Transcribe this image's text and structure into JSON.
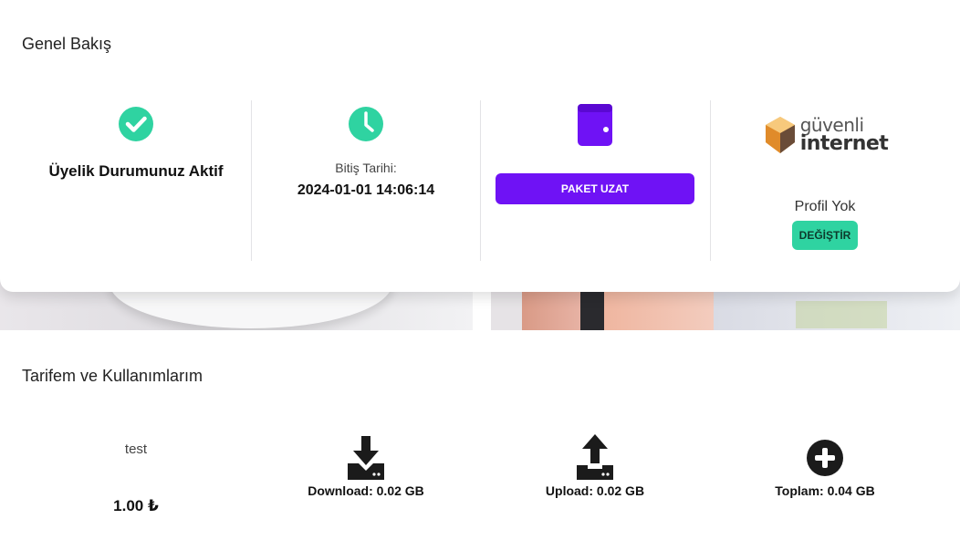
{
  "overview": {
    "title": "Genel Bakış",
    "status": {
      "icon": "check-circle-icon",
      "color": "#2fd3a1",
      "text": "Üyelik Durumunuz Aktif"
    },
    "expiry": {
      "icon": "clock-icon",
      "color": "#2fd3a1",
      "label": "Bitiş Tarihi:",
      "value": "2024-01-01 14:06:14"
    },
    "package": {
      "icon": "wallet-icon",
      "color": "#6f12f5",
      "button_label": "PAKET UZAT"
    },
    "profile": {
      "logo_line1": "güvenli",
      "logo_line2": "internet",
      "text": "Profil Yok",
      "button_label": "DEĞİŞTİR",
      "button_color": "#2fd3a1"
    }
  },
  "usage": {
    "title": "Tarifem ve Kullanımlarım",
    "plan_name": "test",
    "plan_price": "1.00 ₺",
    "download": {
      "icon": "download-icon",
      "label": "Download: 0.02 GB"
    },
    "upload": {
      "icon": "upload-icon",
      "label": "Upload: 0.02 GB"
    },
    "total": {
      "icon": "plus-circle-icon",
      "label": "Toplam: 0.04 GB"
    }
  }
}
